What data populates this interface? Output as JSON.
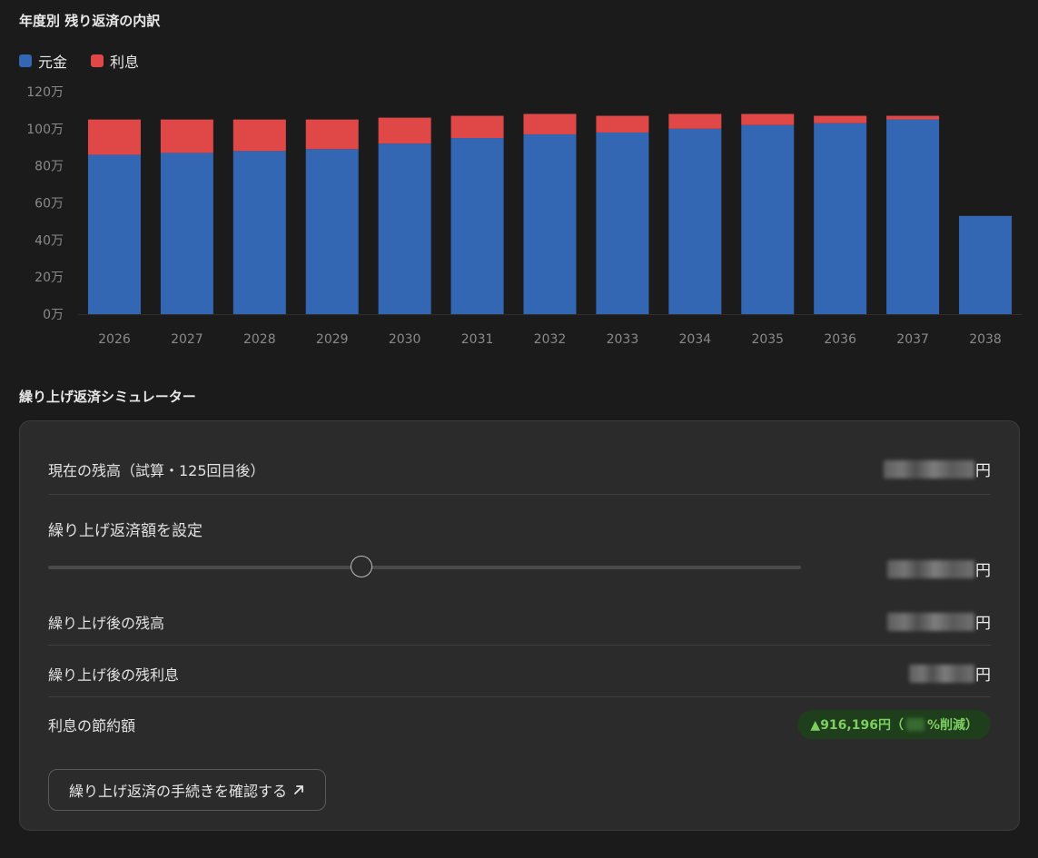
{
  "breakdown": {
    "title": "年度別 残り返済の内訳"
  },
  "legend": [
    {
      "label": "元金",
      "color": "#3366b3"
    },
    {
      "label": "利息",
      "color": "#e04848"
    }
  ],
  "chart_data": {
    "type": "bar",
    "stacked": true,
    "categories": [
      "2026",
      "2027",
      "2028",
      "2029",
      "2030",
      "2031",
      "2032",
      "2033",
      "2034",
      "2035",
      "2036",
      "2037",
      "2038"
    ],
    "series": [
      {
        "name": "元金",
        "color": "#3366b3",
        "values": [
          86,
          87,
          88,
          89,
          92,
          95,
          97,
          98,
          100,
          102,
          103,
          105,
          53
        ]
      },
      {
        "name": "利息",
        "color": "#e04848",
        "values": [
          19,
          18,
          17,
          16,
          14,
          12,
          11,
          9,
          8,
          6,
          4,
          2,
          0
        ]
      }
    ],
    "y_ticks": [
      "0万",
      "20万",
      "40万",
      "60万",
      "80万",
      "100万",
      "120万"
    ],
    "ylim": [
      0,
      120
    ],
    "grid": false
  },
  "simulator": {
    "title": "繰り上げ返済シミュレーター",
    "current_balance_label": "現在の残高（試算・125回目後）",
    "yen": "円",
    "set_amount_label": "繰り上げ返済額を設定",
    "slider_fraction": 0.42,
    "after_balance_label": "繰り上げ後の残高",
    "after_interest_label": "繰り上げ後の残利息",
    "savings_label": "利息の節約額",
    "savings_value": "▲916,196円（",
    "savings_suffix": "%削減）",
    "cta_label": "繰り上げ返済の手続きを確認する",
    "cta_icon": "external-arrow-icon"
  }
}
